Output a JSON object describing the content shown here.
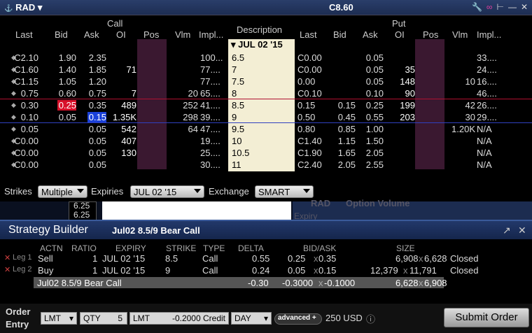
{
  "window": {
    "symbol": "RAD",
    "price": "C8.60"
  },
  "headers": {
    "call": "Call",
    "put": "Put",
    "description": "Description",
    "expiry": "JUL 02 '15",
    "call_cols": [
      "Last",
      "Bid",
      "Ask",
      "OI",
      "Pos",
      "Vlm",
      "Impl..."
    ],
    "put_cols": [
      "Last",
      "Bid",
      "Ask",
      "OI",
      "Pos",
      "Vlm",
      "Impl..."
    ]
  },
  "rows": [
    {
      "c_last": "C2.10",
      "c_bid": "1.90",
      "c_ask": "2.35",
      "c_oi": "",
      "c_vlm": "",
      "c_impl": "100...",
      "strike": "6.5",
      "p_last": "C0.00",
      "p_bid": "",
      "p_ask": "0.05",
      "p_oi": "",
      "p_vlm": "",
      "p_impl": "33...."
    },
    {
      "c_last": "C1.60",
      "c_bid": "1.40",
      "c_ask": "1.85",
      "c_oi": "71",
      "c_vlm": "",
      "c_impl": "77....",
      "strike": "7",
      "p_last": "C0.00",
      "p_bid": "",
      "p_ask": "0.05",
      "p_oi": "35",
      "p_vlm": "",
      "p_impl": "24...."
    },
    {
      "c_last": "C1.15",
      "c_bid": "1.05",
      "c_ask": "1.20",
      "c_oi": "",
      "c_vlm": "",
      "c_impl": "77....",
      "strike": "7.5",
      "p_last": "0.00",
      "p_bid": "",
      "p_ask": "0.05",
      "p_oi": "148",
      "p_vlm": "10",
      "p_impl": "16...."
    },
    {
      "c_last": "0.75",
      "c_bid": "0.60",
      "c_ask": "0.75",
      "c_oi": "7",
      "c_vlm": "20",
      "c_impl": "65....",
      "strike": "8",
      "p_last": "C0.10",
      "p_bid": "",
      "p_ask": "0.10",
      "p_oi": "90",
      "p_vlm": "",
      "p_impl": "46...."
    },
    {
      "c_last": "0.30",
      "c_bid": "0.25",
      "c_ask": "0.35",
      "c_oi": "489",
      "c_vlm": "252",
      "c_impl": "41....",
      "strike": "8.5",
      "p_last": "0.15",
      "p_bid": "0.15",
      "p_ask": "0.25",
      "p_oi": "199",
      "p_vlm": "42",
      "p_impl": "26...."
    },
    {
      "c_last": "0.10",
      "c_bid": "0.05",
      "c_ask": "0.15",
      "c_oi": "1.35K",
      "c_vlm": "298",
      "c_impl": "39....",
      "strike": "9",
      "p_last": "0.50",
      "p_bid": "0.45",
      "p_ask": "0.55",
      "p_oi": "203",
      "p_vlm": "30",
      "p_impl": "29...."
    },
    {
      "c_last": "0.05",
      "c_bid": "",
      "c_ask": "0.05",
      "c_oi": "542",
      "c_vlm": "64",
      "c_impl": "47....",
      "strike": "9.5",
      "p_last": "0.80",
      "p_bid": "0.85",
      "p_ask": "1.00",
      "p_oi": "",
      "p_vlm": "1.20K",
      "p_impl": "N/A"
    },
    {
      "c_last": "C0.00",
      "c_bid": "",
      "c_ask": "0.05",
      "c_oi": "407",
      "c_vlm": "",
      "c_impl": "19....",
      "strike": "10",
      "p_last": "C1.40",
      "p_bid": "1.15",
      "p_ask": "1.50",
      "p_oi": "",
      "p_vlm": "",
      "p_impl": "N/A"
    },
    {
      "c_last": "C0.00",
      "c_bid": "",
      "c_ask": "0.05",
      "c_oi": "130",
      "c_vlm": "",
      "c_impl": "25....",
      "strike": "10.5",
      "p_last": "C1.90",
      "p_bid": "1.65",
      "p_ask": "2.05",
      "p_oi": "",
      "p_vlm": "",
      "p_impl": "N/A"
    },
    {
      "c_last": "C0.00",
      "c_bid": "",
      "c_ask": "0.05",
      "c_oi": "",
      "c_vlm": "",
      "c_impl": "30....",
      "strike": "11",
      "p_last": "C2.40",
      "p_bid": "2.05",
      "p_ask": "2.55",
      "p_oi": "",
      "p_vlm": "",
      "p_impl": "N/A"
    }
  ],
  "controls": {
    "strikes_label": "Strikes",
    "strikes_value": "Multiple",
    "expiries_label": "Expiries",
    "expiries_value": "JUL 02 '15",
    "exchange_label": "Exchange",
    "exchange_value": "SMART"
  },
  "background": {
    "price1": "6.25",
    "price2": "6.25",
    "symbol": "RAD",
    "panel": "Option Volume",
    "exp": "Expiry"
  },
  "builder": {
    "title": "Strategy Builder",
    "subtitle": "Jul02 8.5/9 Bear Call",
    "cols": [
      "ACTN",
      "RATIO",
      "EXPIRY",
      "STRIKE",
      "TYPE",
      "DELTA",
      "BID/ASK",
      "SIZE"
    ],
    "legs": [
      {
        "leg": "Leg 1",
        "actn": "Sell",
        "ratio": "1",
        "expiry": "JUL 02 '15",
        "strike": "8.5",
        "type": "Call",
        "delta": "0.55",
        "bid": "0.25",
        "ask": "0.35",
        "size_b": "6,908",
        "size_a": "6,628",
        "status": "Closed"
      },
      {
        "leg": "Leg 2",
        "actn": "Buy",
        "ratio": "1",
        "expiry": "JUL 02 '15",
        "strike": "9",
        "type": "Call",
        "delta": "0.24",
        "bid": "0.05",
        "ask": "0.15",
        "size_b": "12,379",
        "size_a": "11,791",
        "status": "Closed"
      }
    ],
    "summary": {
      "name": "Jul02 8.5/9 Bear Call",
      "delta": "-0.30",
      "bid": "-0.3000",
      "ask": "-0.1000",
      "size_b": "6,628",
      "size_a": "6,908"
    }
  },
  "order": {
    "label1": "Order",
    "label2": "Entry",
    "type": "LMT",
    "qty_label": "QTY",
    "qty": "5",
    "lmt_label": "LMT",
    "lmt_value": "-0.2000 Credit",
    "tif": "DAY",
    "advanced": "advanced",
    "amount": "250 USD",
    "submit": "Submit Order"
  }
}
